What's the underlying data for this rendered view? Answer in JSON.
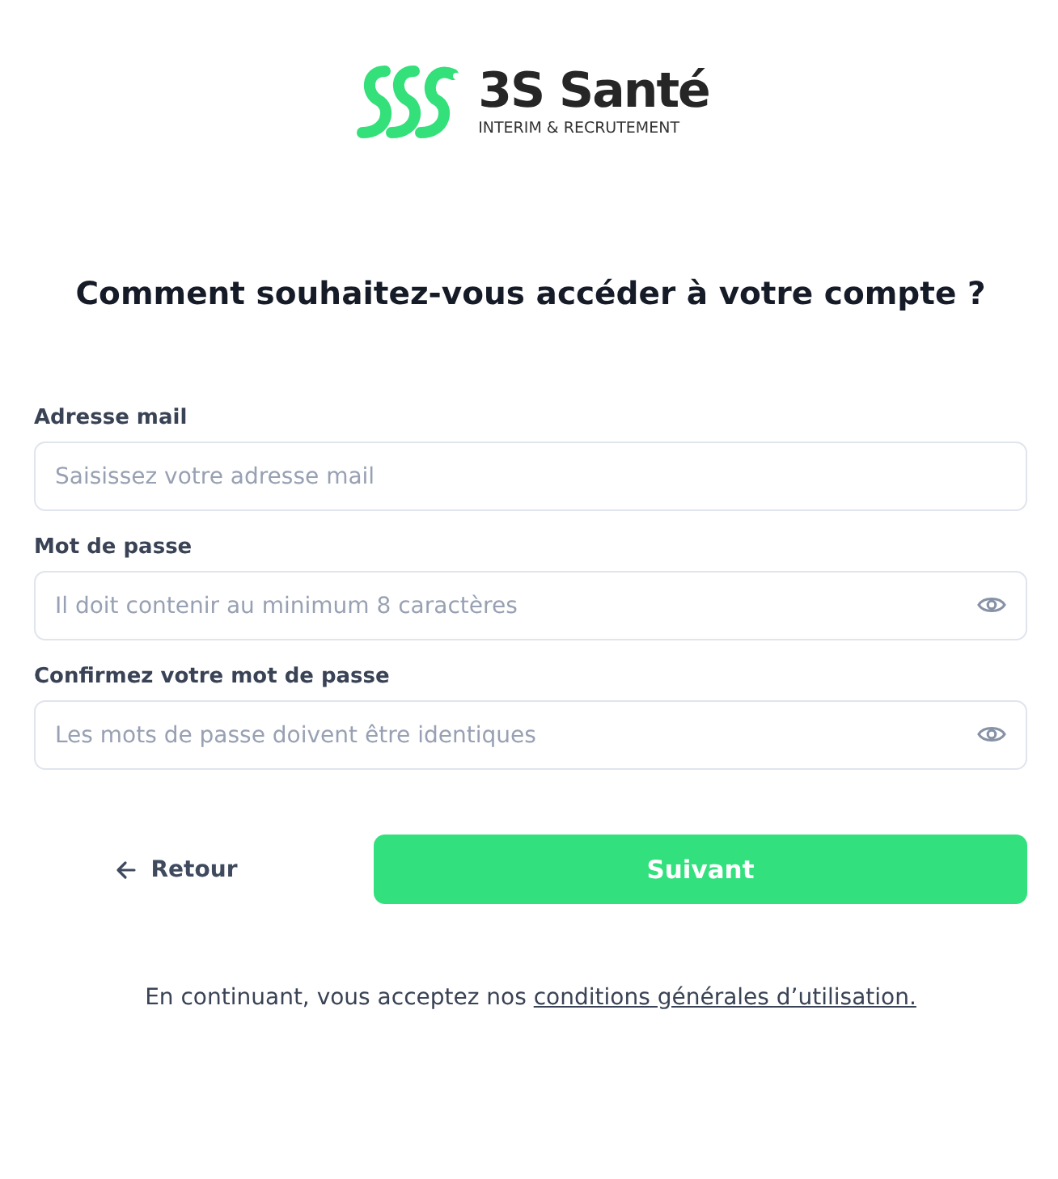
{
  "logo": {
    "name": "3S Santé",
    "tagline": "INTERIM & RECRUTEMENT"
  },
  "heading": "Comment souhaitez-vous accéder à votre compte ?",
  "fields": [
    {
      "label": "Adresse mail",
      "placeholder": "Saisissez votre adresse mail",
      "kind": "email"
    },
    {
      "label": "Mot de passe",
      "placeholder": "Il doit contenir au minimum 8 caractères",
      "kind": "password"
    },
    {
      "label": "Confirmez votre mot de passe",
      "placeholder": "Les mots de passe doivent être identiques",
      "kind": "password"
    }
  ],
  "back_button": "Retour",
  "next_button": "Suivant",
  "footer": {
    "text": "En continuant, vous acceptez nos ",
    "link": "conditions générales d’utilisation."
  }
}
